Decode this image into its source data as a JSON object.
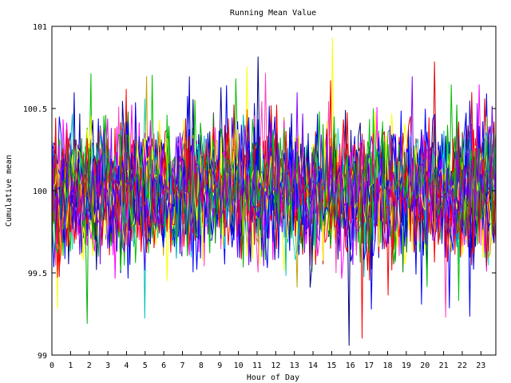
{
  "chart_data": {
    "type": "line",
    "title": "Running Mean Value",
    "xlabel": "Hour of Day",
    "ylabel": "Cumulative mean",
    "xlim": [
      0,
      23.8
    ],
    "ylim": [
      99,
      101
    ],
    "x_ticks": [
      "0",
      "1",
      "2",
      "3",
      "4",
      "5",
      "6",
      "7",
      "8",
      "9",
      "10",
      "11",
      "12",
      "13",
      "14",
      "15",
      "16",
      "17",
      "18",
      "19",
      "20",
      "21",
      "22",
      "23"
    ],
    "y_ticks": [
      "99",
      "99.5",
      "100",
      "100.5",
      "101"
    ],
    "grid": false,
    "legend": "none",
    "series_count": 24,
    "points_per_series": 240,
    "series_colors": [
      "#ff0000",
      "#00c000",
      "#0000ff",
      "#ff00ff",
      "#00e0e0",
      "#c0a000",
      "#ffff00",
      "#000080",
      "#c00000",
      "#0000c0",
      "#008000",
      "#ff40c0",
      "#ff0000",
      "#0000ff",
      "#00c000",
      "#ff00ff",
      "#0000ff",
      "#e00000",
      "#00c0c0",
      "#ffff00",
      "#0000ff",
      "#ff0000",
      "#00b000",
      "#8000ff"
    ],
    "summary": {
      "center": 100.0,
      "typical_spread": 0.25,
      "max_observed": 100.92,
      "min_observed": 99.0
    }
  }
}
